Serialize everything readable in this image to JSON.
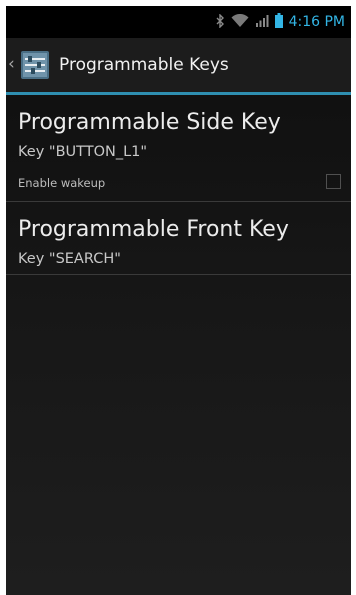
{
  "status_bar": {
    "time": "4:16 PM",
    "icons": [
      "bluetooth-icon",
      "wifi-icon",
      "signal-icon",
      "battery-icon"
    ],
    "time_color": "#33b5e5"
  },
  "action_bar": {
    "title": "Programmable Keys",
    "up_icon": "chevron-left-icon",
    "app_icon": "settings-sliders-icon",
    "accent_color": "#2f8fb1"
  },
  "preferences": [
    {
      "title": "Programmable Side Key",
      "summary": "Key \"BUTTON_L1\"",
      "option_label": "Enable wakeup",
      "option_checked": false
    },
    {
      "title": "Programmable Front Key",
      "summary": "Key \"SEARCH\""
    }
  ]
}
